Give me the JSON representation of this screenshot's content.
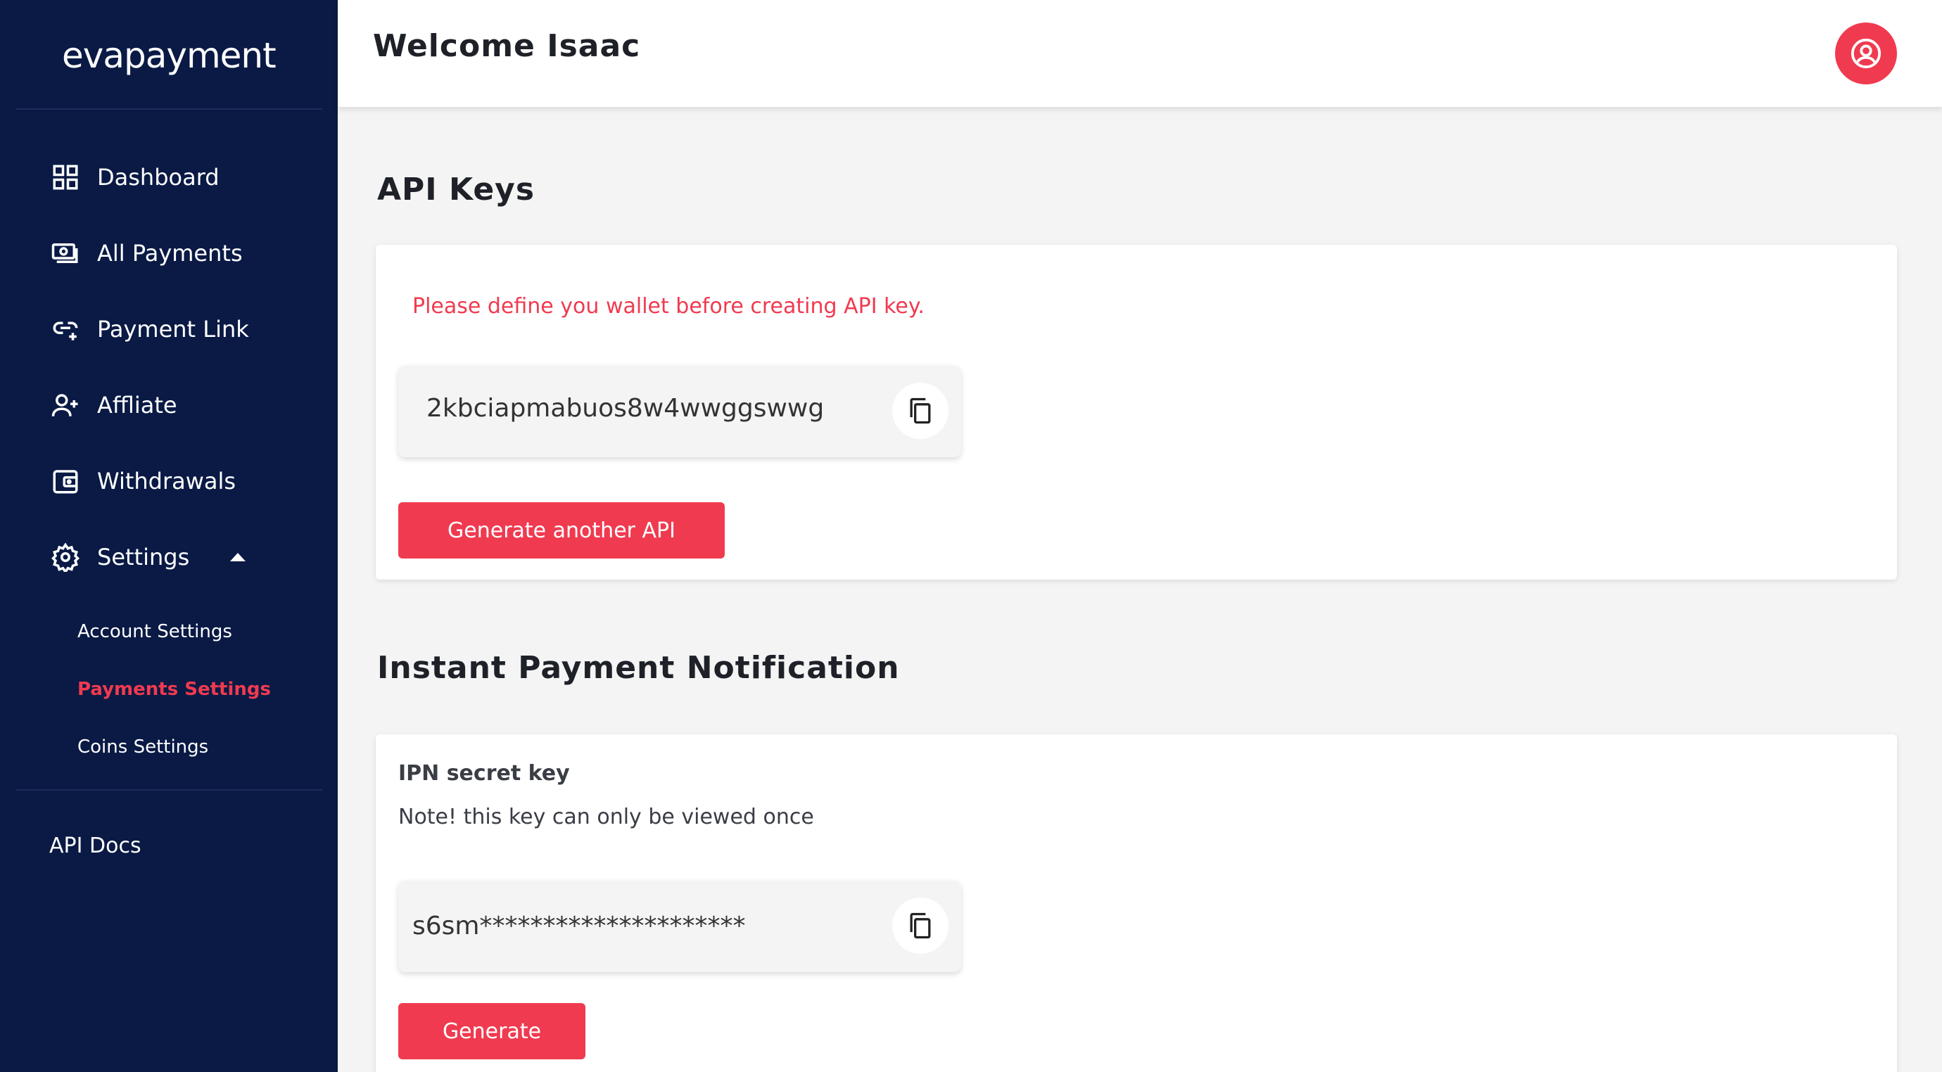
{
  "brand": {
    "logo_text": "evapayment",
    "accent": "#f03a50",
    "sidebar_bg": "#0a1a45"
  },
  "sidebar": {
    "items": [
      {
        "label": "Dashboard",
        "icon": "grid-icon"
      },
      {
        "label": "All Payments",
        "icon": "cash-icon"
      },
      {
        "label": "Payment Link",
        "icon": "link-icon"
      },
      {
        "label": "Affliate",
        "icon": "user-plus-icon"
      },
      {
        "label": "Withdrawals",
        "icon": "wallet-icon"
      },
      {
        "label": "Settings",
        "icon": "gear-icon",
        "expanded": true
      }
    ],
    "settings_sub": [
      {
        "label": "Account Settings",
        "active": false
      },
      {
        "label": "Payments Settings",
        "active": true
      },
      {
        "label": "Coins Settings",
        "active": false
      }
    ],
    "api_docs": "API Docs"
  },
  "header": {
    "welcome": "Welcome Isaac",
    "avatar_icon": "user-circle-icon"
  },
  "api_keys": {
    "title": "API Keys",
    "warning": "Please define you wallet before creating API key.",
    "key": "2kbciapmabuos8w4wwggswwg",
    "copy_icon": "copy-icon",
    "button": "Generate another API"
  },
  "ipn": {
    "title": "Instant Payment Notification",
    "label": "IPN secret key",
    "note": "Note! this key can only be viewed once",
    "key": "s6sm*********************",
    "copy_icon": "copy-icon",
    "button": "Generate"
  }
}
